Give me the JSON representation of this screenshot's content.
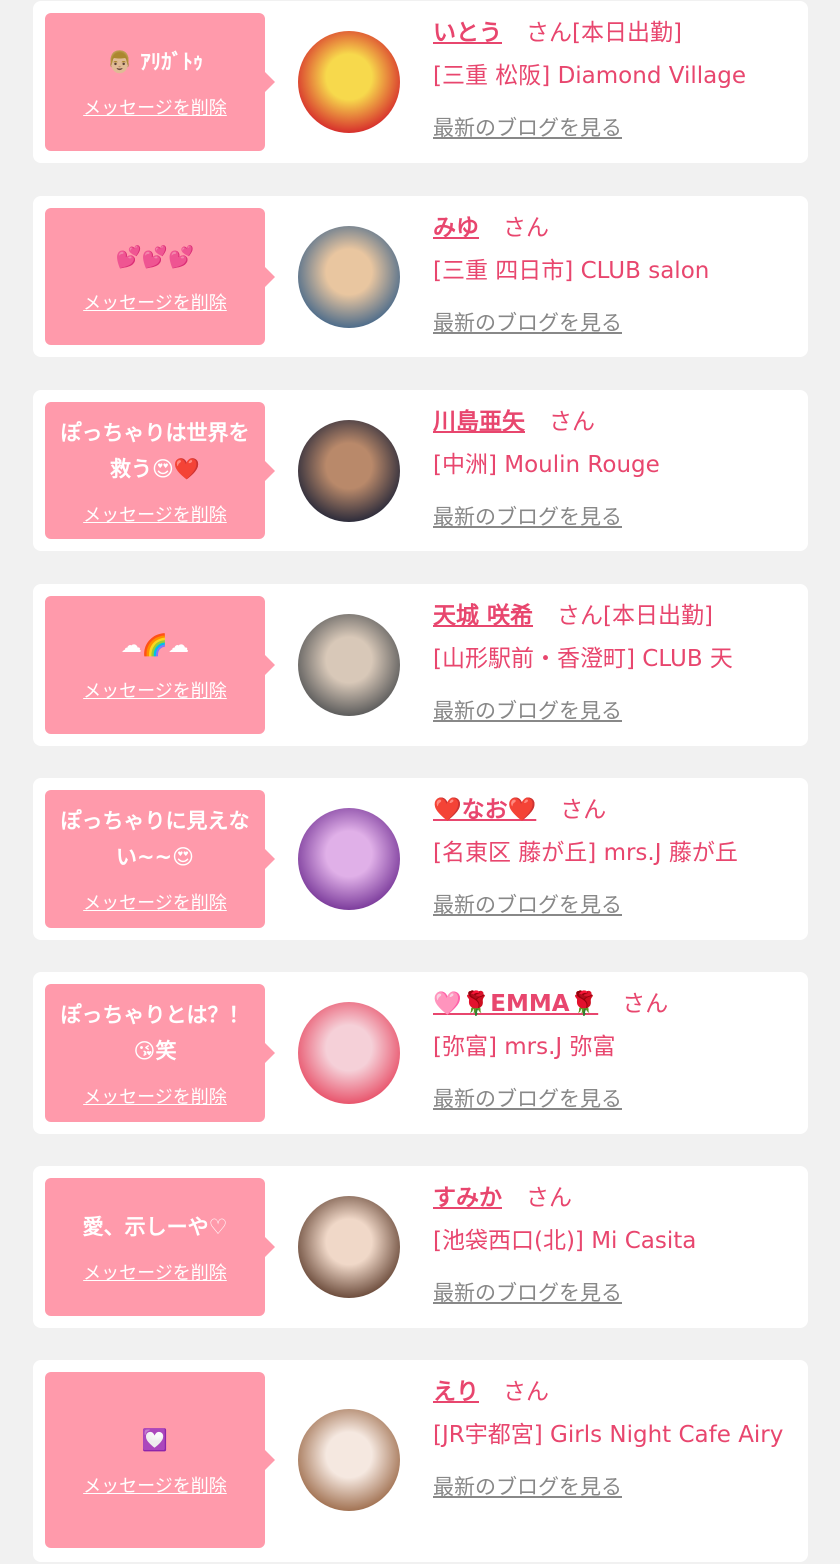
{
  "cards": [
    {
      "message": "👨🏼 ｱﾘｶﾞﾄｩ",
      "delete_label": "メッセージを削除",
      "name": "いとう",
      "suffix": "さん[本日出勤]",
      "store": "[三重 松阪] Diamond Village",
      "blog_label": "最新のブログを見る",
      "avatar_colors": [
        "#d62b2b",
        "#f7d94c"
      ]
    },
    {
      "message": "💕💕💕",
      "delete_label": "メッセージを削除",
      "name": "みゆ",
      "suffix": "さん",
      "store": "[三重 四日市] CLUB salon",
      "blog_label": "最新のブログを見る",
      "avatar_colors": [
        "#4a6a8a",
        "#e9c6a0"
      ]
    },
    {
      "message": "ぽっちゃりは世界を救う😍❤️",
      "delete_label": "メッセージを削除",
      "name": "川島亜矢",
      "suffix": "さん",
      "store": "[中洲] Moulin Rouge",
      "blog_label": "最新のブログを見る",
      "avatar_colors": [
        "#2a2a3a",
        "#b9896a"
      ]
    },
    {
      "message": "☁🌈☁",
      "delete_label": "メッセージを削除",
      "name": "天城 咲希",
      "suffix": "さん[本日出勤]",
      "store": "[山形駅前・香澄町] CLUB 天",
      "blog_label": "最新のブログを見る",
      "avatar_colors": [
        "#5a5a5a",
        "#d8c8b8"
      ]
    },
    {
      "message": "ぽっちゃりに見えない~~😍",
      "delete_label": "メッセージを削除",
      "name": "❤️なお❤️",
      "suffix": "さん",
      "store": "[名東区 藤が丘] mrs.J 藤が丘",
      "blog_label": "最新のブログを見る",
      "avatar_colors": [
        "#7a3a9a",
        "#e0b0e8"
      ]
    },
    {
      "message": "ぽっちゃりとは？！😘笑",
      "delete_label": "メッセージを削除",
      "name": "🩷🌹EMMA🌹",
      "suffix": "さん",
      "store": "[弥富] mrs.J 弥富",
      "blog_label": "最新のブログを見る",
      "avatar_colors": [
        "#e8526a",
        "#f5d0d8"
      ]
    },
    {
      "message": "愛、示しーや♡",
      "delete_label": "メッセージを削除",
      "name": "すみか",
      "suffix": "さん",
      "store": "[池袋西口(北)] Mi Casita",
      "blog_label": "最新のブログを見る",
      "avatar_colors": [
        "#6a4a3a",
        "#f0d8c8"
      ]
    },
    {
      "message": "💟",
      "delete_label": "メッセージを削除",
      "name": "えり",
      "suffix": "さん",
      "store": "[JR宇都宮] Girls Night Cafe Airy",
      "blog_label": "最新のブログを見る",
      "avatar_colors": [
        "#a07050",
        "#f5e8e0"
      ]
    }
  ]
}
